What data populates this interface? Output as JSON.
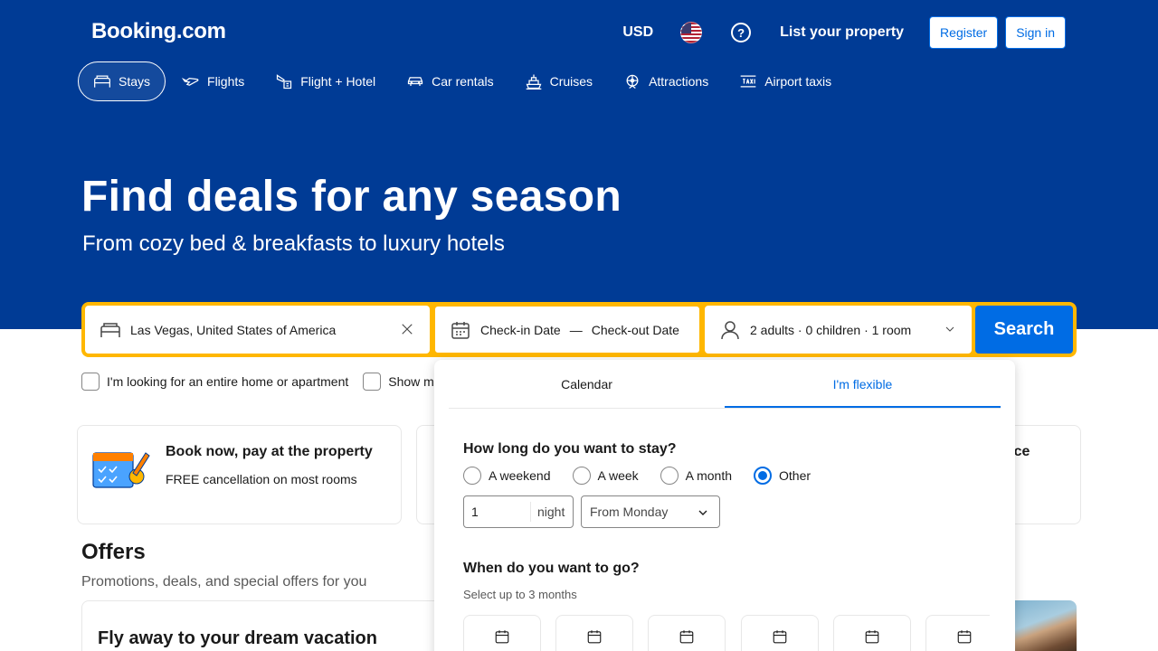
{
  "header": {
    "logo": "Booking.com",
    "currency": "USD",
    "help": "?",
    "list_property": "List your property",
    "register": "Register",
    "sign_in": "Sign in"
  },
  "nav": {
    "items": [
      {
        "label": "Stays",
        "icon": "bed-icon",
        "active": true
      },
      {
        "label": "Flights",
        "icon": "plane-icon"
      },
      {
        "label": "Flight + Hotel",
        "icon": "plane-hotel-icon"
      },
      {
        "label": "Car rentals",
        "icon": "car-icon"
      },
      {
        "label": "Cruises",
        "icon": "ship-icon"
      },
      {
        "label": "Attractions",
        "icon": "attractions-icon"
      },
      {
        "label": "Airport taxis",
        "icon": "taxi-icon"
      }
    ]
  },
  "hero": {
    "title": "Find deals for any season",
    "subtitle": "From cozy bed & breakfasts to luxury hotels"
  },
  "search": {
    "destination": "Las Vegas, United States of America",
    "checkin": "Check-in Date",
    "dash": "—",
    "checkout": "Check-out Date",
    "guests": "2 adults · 0 children · 1 room",
    "button": "Search",
    "accent_color": "#ffb700"
  },
  "filters": {
    "entire_home": "I'm looking for an entire home or apartment",
    "show": "Show m"
  },
  "cards": {
    "card1_title": "Book now, pay at the property",
    "card1_sub": "FREE cancellation on most rooms",
    "card3_title": "rvice"
  },
  "offers": {
    "title": "Offers",
    "subtitle": "Promotions, deals, and special offers for you",
    "card_title": "Fly away to your dream vacation"
  },
  "flexible_panel": {
    "tabs": [
      {
        "label": "Calendar",
        "active": false
      },
      {
        "label": "I'm flexible",
        "active": true
      }
    ],
    "stay_question": "How long do you want to stay?",
    "stay_options": [
      {
        "label": "A weekend",
        "selected": false
      },
      {
        "label": "A week",
        "selected": false
      },
      {
        "label": "A month",
        "selected": false
      },
      {
        "label": "Other",
        "selected": true
      }
    ],
    "nights_value": "1",
    "nights_unit": "night",
    "from_day": "From Monday",
    "go_question": "When do you want to go?",
    "go_hint": "Select up to 3 months"
  },
  "colors": {
    "brand_blue": "#003b95",
    "action_blue": "#006ce4",
    "yellow": "#ffb700"
  }
}
